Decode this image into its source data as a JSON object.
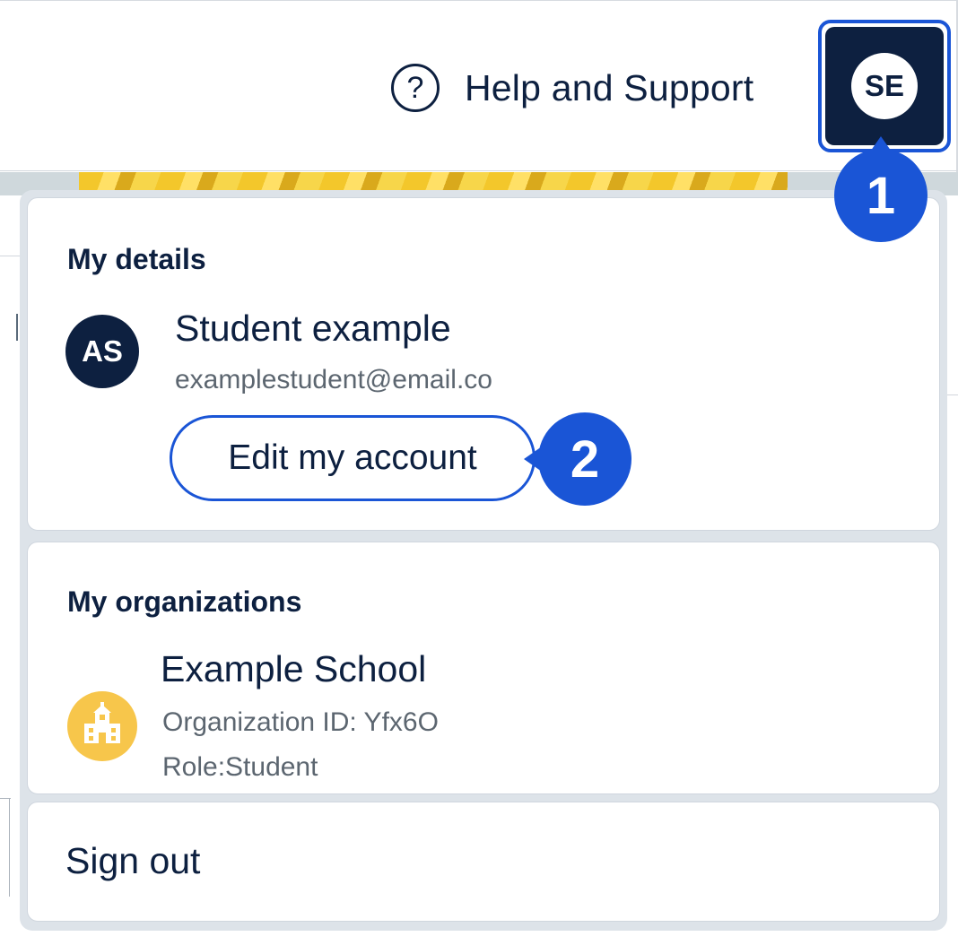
{
  "header": {
    "help_icon": "question-circle-icon",
    "help_icon_glyph": "?",
    "help_label": "Help and Support",
    "avatar_initials": "SE"
  },
  "callouts": {
    "step_one": "1",
    "step_two": "2"
  },
  "menu": {
    "details": {
      "title": "My details",
      "avatar_initials": "AS",
      "name": "Student example",
      "email": "examplestudent@email.co",
      "edit_button": "Edit my account"
    },
    "organizations": {
      "title": "My organizations",
      "icon": "school-building-icon",
      "name": "Example School",
      "org_id": "Organization ID: Yfx6O",
      "role": "Role:Student"
    },
    "sign_out": "Sign out"
  },
  "colors": {
    "navy": "#0d2040",
    "accent_blue": "#1a55d6",
    "org_icon_yellow": "#f7c64b",
    "secondary_text": "#5c6670"
  }
}
